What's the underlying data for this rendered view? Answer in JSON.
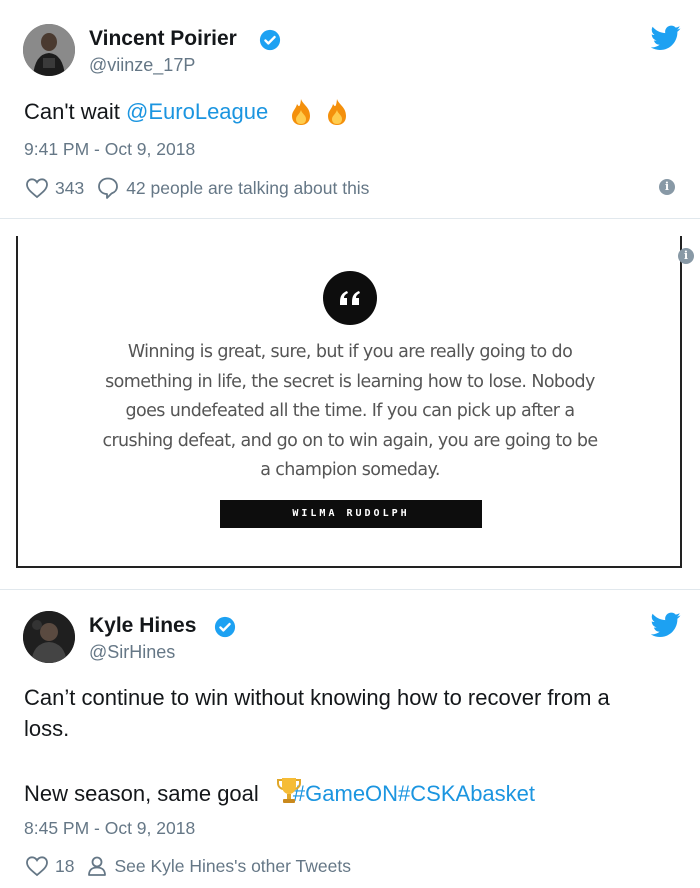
{
  "tweet1": {
    "name": "Vincent Poirier",
    "handle": "@viinze_17P",
    "text_prefix": "Can't wait ",
    "mention": "@EuroLeague",
    "emoji": [
      "fire",
      "fire"
    ],
    "timestamp": "9:41 PM - Oct 9, 2018",
    "likes": "343",
    "replies_text": "42 people are talking about this"
  },
  "quote_card": {
    "quote_lines": [
      "Winning is great, sure, but if you are really going to do",
      "something in life, the secret is learning how to lose. Nobody",
      "goes undefeated all the time. If you can pick up after a",
      "crushing defeat, and go on to win again, you are going to be",
      "a champion someday."
    ],
    "author": "WILMA RUDOLPH"
  },
  "tweet2": {
    "name": "Kyle Hines",
    "handle": "@SirHines",
    "line1": "Can’t continue to win without knowing how to recover from a",
    "line2": "loss.",
    "line3_prefix": "New season, same goal ",
    "emoji": "trophy",
    "hashtags": "#GameON#CSKAbasket",
    "timestamp": "8:45 PM - Oct 9, 2018",
    "likes": "18",
    "other_tweets": "See Kyle Hines's other Tweets"
  },
  "colors": {
    "link": "#1b95e0",
    "verified": "#1da1f2",
    "secondary_text": "#657786",
    "divider": "#e1e8ed"
  }
}
